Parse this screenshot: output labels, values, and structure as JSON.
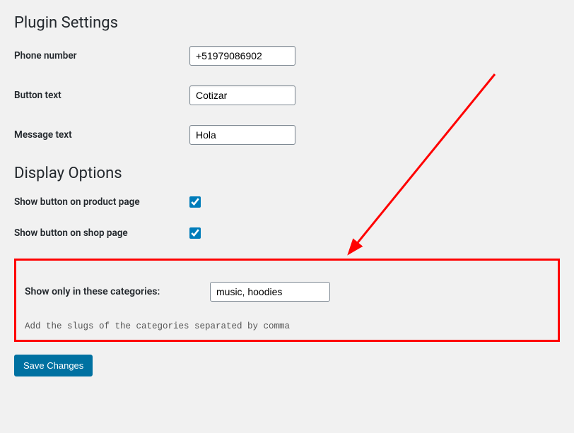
{
  "sections": {
    "plugin_settings": {
      "title": "Plugin Settings",
      "fields": {
        "phone": {
          "label": "Phone number",
          "value": "+51979086902"
        },
        "button_text": {
          "label": "Button text",
          "value": "Cotizar"
        },
        "message_text": {
          "label": "Message text",
          "value": "Hola"
        }
      }
    },
    "display_options": {
      "title": "Display Options",
      "fields": {
        "show_on_product": {
          "label": "Show button on product page",
          "checked": true
        },
        "show_on_shop": {
          "label": "Show button on shop page",
          "checked": true
        }
      }
    },
    "categories_box": {
      "label": "Show only in these categories:",
      "value": "music, hoodies",
      "hint": "Add the slugs of the categories separated by comma"
    }
  },
  "save_button": "Save Changes",
  "annotation": {
    "arrow_color": "#ff0000",
    "box_color": "#ff0000"
  }
}
